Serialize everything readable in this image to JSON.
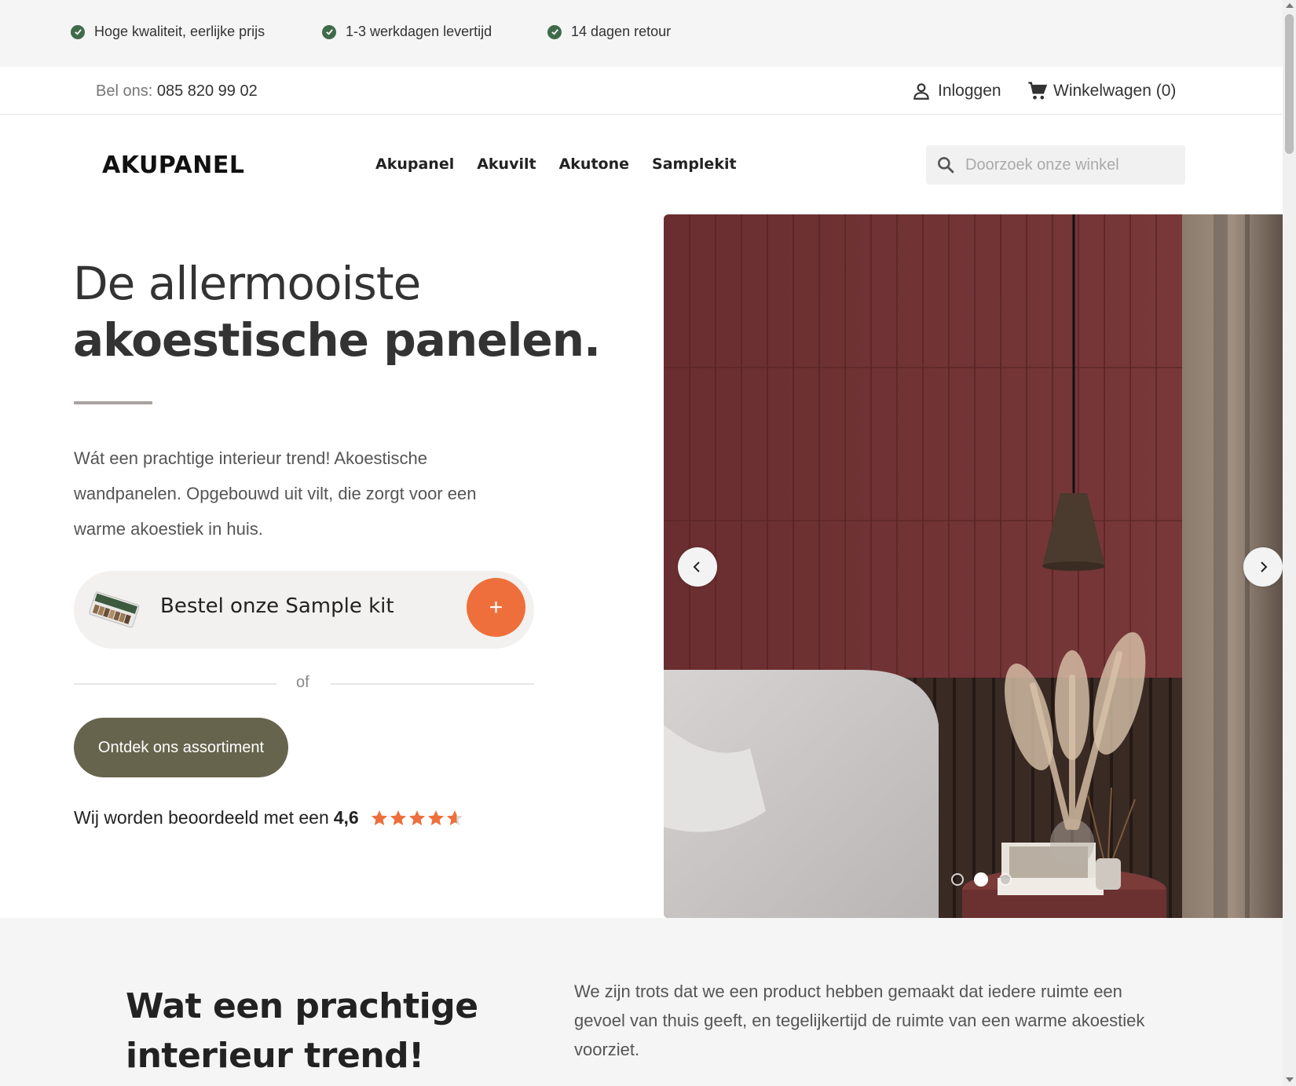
{
  "usp": [
    {
      "label": "Hoge kwaliteit, eerlijke prijs"
    },
    {
      "label": "1-3 werkdagen levertijd"
    },
    {
      "label": "14 dagen retour"
    }
  ],
  "contact": {
    "prefix": "Bel ons:",
    "phone": "085 820 99 02",
    "login_label": "Inloggen",
    "cart_label": "Winkelwagen (0)"
  },
  "header": {
    "logo": "AKUPANEL",
    "nav": [
      "Akupanel",
      "Akuvilt",
      "Akutone",
      "Samplekit"
    ],
    "search_placeholder": "Doorzoek onze winkel"
  },
  "hero": {
    "title_line1": "De allermooiste",
    "title_line2": "akoestische panelen.",
    "text": "Wát een prachtige interieur trend! Akoestische wandpanelen. Opgebouwd uit vilt, die zorgt voor een warme akoestiek in huis.",
    "sample_label": "Bestel onze Sample kit",
    "plus": "+",
    "or": "of",
    "cta": "Ontdek ons assortiment",
    "rating_prefix": "Wij worden beoordeeld met een",
    "rating_score": "4,6",
    "rating_value": 4.6,
    "rating_max": 5,
    "slides_total": 3,
    "slide_active": 2
  },
  "lower": {
    "title_line1": "Wat een prachtige",
    "title_line2": "interieur trend!",
    "text": "We zijn trots dat we een product hebben gemaakt dat iedere ruimte een gevoel van thuis geeft, en tegelijkertijd de ruimte van een warme akoestiek voorziet."
  },
  "colors": {
    "accent_orange": "#ee6f3b",
    "cta_olive": "#67644e",
    "check_green": "#3f6b4a",
    "panel_red": "#6e2f2f"
  }
}
